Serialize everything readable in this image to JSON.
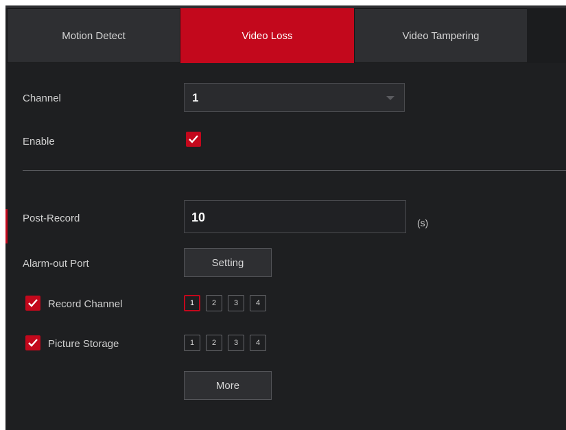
{
  "tabs": [
    {
      "label": "Motion Detect",
      "active": false
    },
    {
      "label": "Video Loss",
      "active": true
    },
    {
      "label": "Video Tampering",
      "active": false
    }
  ],
  "form": {
    "channel_label": "Channel",
    "channel_value": "1",
    "enable_label": "Enable",
    "enable_checked": true,
    "post_record_label": "Post-Record",
    "post_record_value": "10",
    "post_record_unit": "(s)",
    "alarm_out_label": "Alarm-out Port",
    "setting_button": "Setting",
    "record_channel_label": "Record Channel",
    "record_channel_checked": true,
    "record_channels": [
      "1",
      "2",
      "3",
      "4"
    ],
    "record_channel_selected": "1",
    "picture_storage_label": "Picture Storage",
    "picture_storage_checked": true,
    "picture_channels": [
      "1",
      "2",
      "3",
      "4"
    ],
    "more_button": "More"
  },
  "colors": {
    "accent": "#c3081c",
    "background": "#1e1f21",
    "tab_inactive": "#2e2f32"
  }
}
